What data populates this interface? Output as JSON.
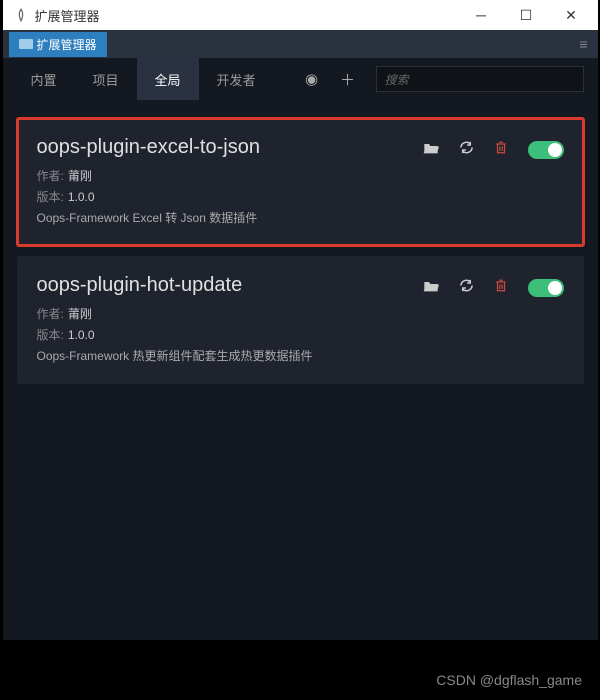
{
  "window": {
    "title": "扩展管理器"
  },
  "subheader": {
    "tab": "扩展管理器"
  },
  "tabs": {
    "builtin": "内置",
    "project": "项目",
    "global": "全局",
    "developer": "开发者"
  },
  "search": {
    "placeholder": "搜索"
  },
  "plugins": [
    {
      "name": "oops-plugin-excel-to-json",
      "author_label": "作者:",
      "author": "莆刚",
      "version_label": "版本:",
      "version": "1.0.0",
      "desc": "Oops-Framework Excel 转 Json 数据插件"
    },
    {
      "name": "oops-plugin-hot-update",
      "author_label": "作者:",
      "author": "莆刚",
      "version_label": "版本:",
      "version": "1.0.0",
      "desc": "Oops-Framework 热更新组件配套生成热更数据插件"
    }
  ],
  "watermark": "CSDN @dgflash_game"
}
